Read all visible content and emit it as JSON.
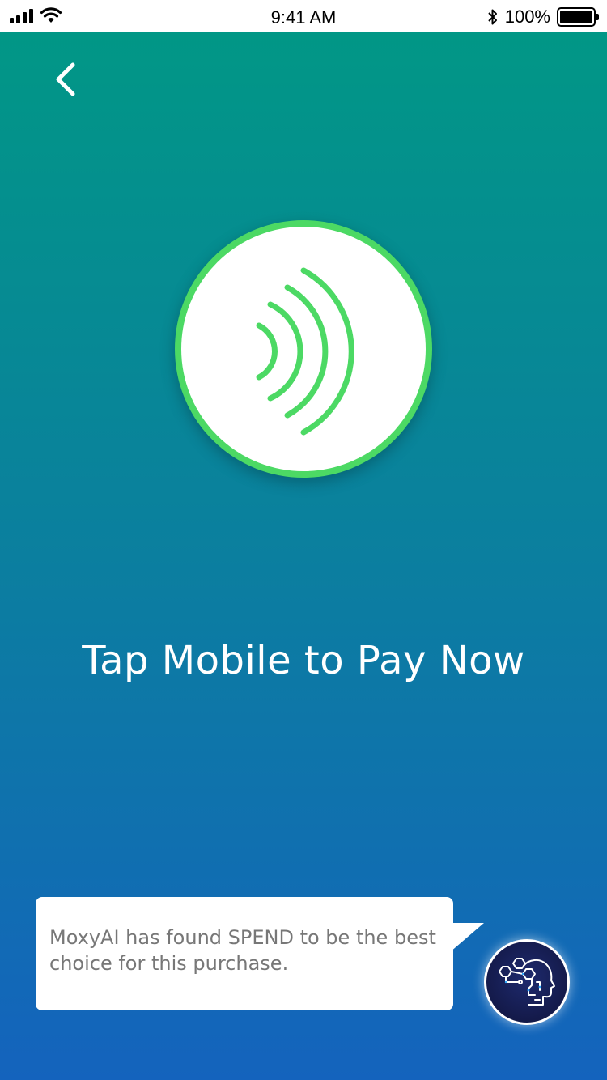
{
  "status_bar": {
    "time": "9:41 AM",
    "battery_percent": "100%",
    "icons": [
      "signal-icon",
      "wifi-icon",
      "bluetooth-icon",
      "battery-icon"
    ]
  },
  "header": {
    "back_icon": "chevron-left-icon"
  },
  "payment": {
    "nfc_icon": "contactless-icon",
    "headline": "Tap Mobile to Pay Now"
  },
  "assistant": {
    "message": "MoxyAI has found SPEND to be the best choice for this purchase.",
    "avatar_icon": "ai-head-icon"
  },
  "colors": {
    "gradient_top": "#019786",
    "gradient_bottom": "#1463BD",
    "nfc_green": "#4CD964",
    "avatar_bg": "#141A4A"
  }
}
